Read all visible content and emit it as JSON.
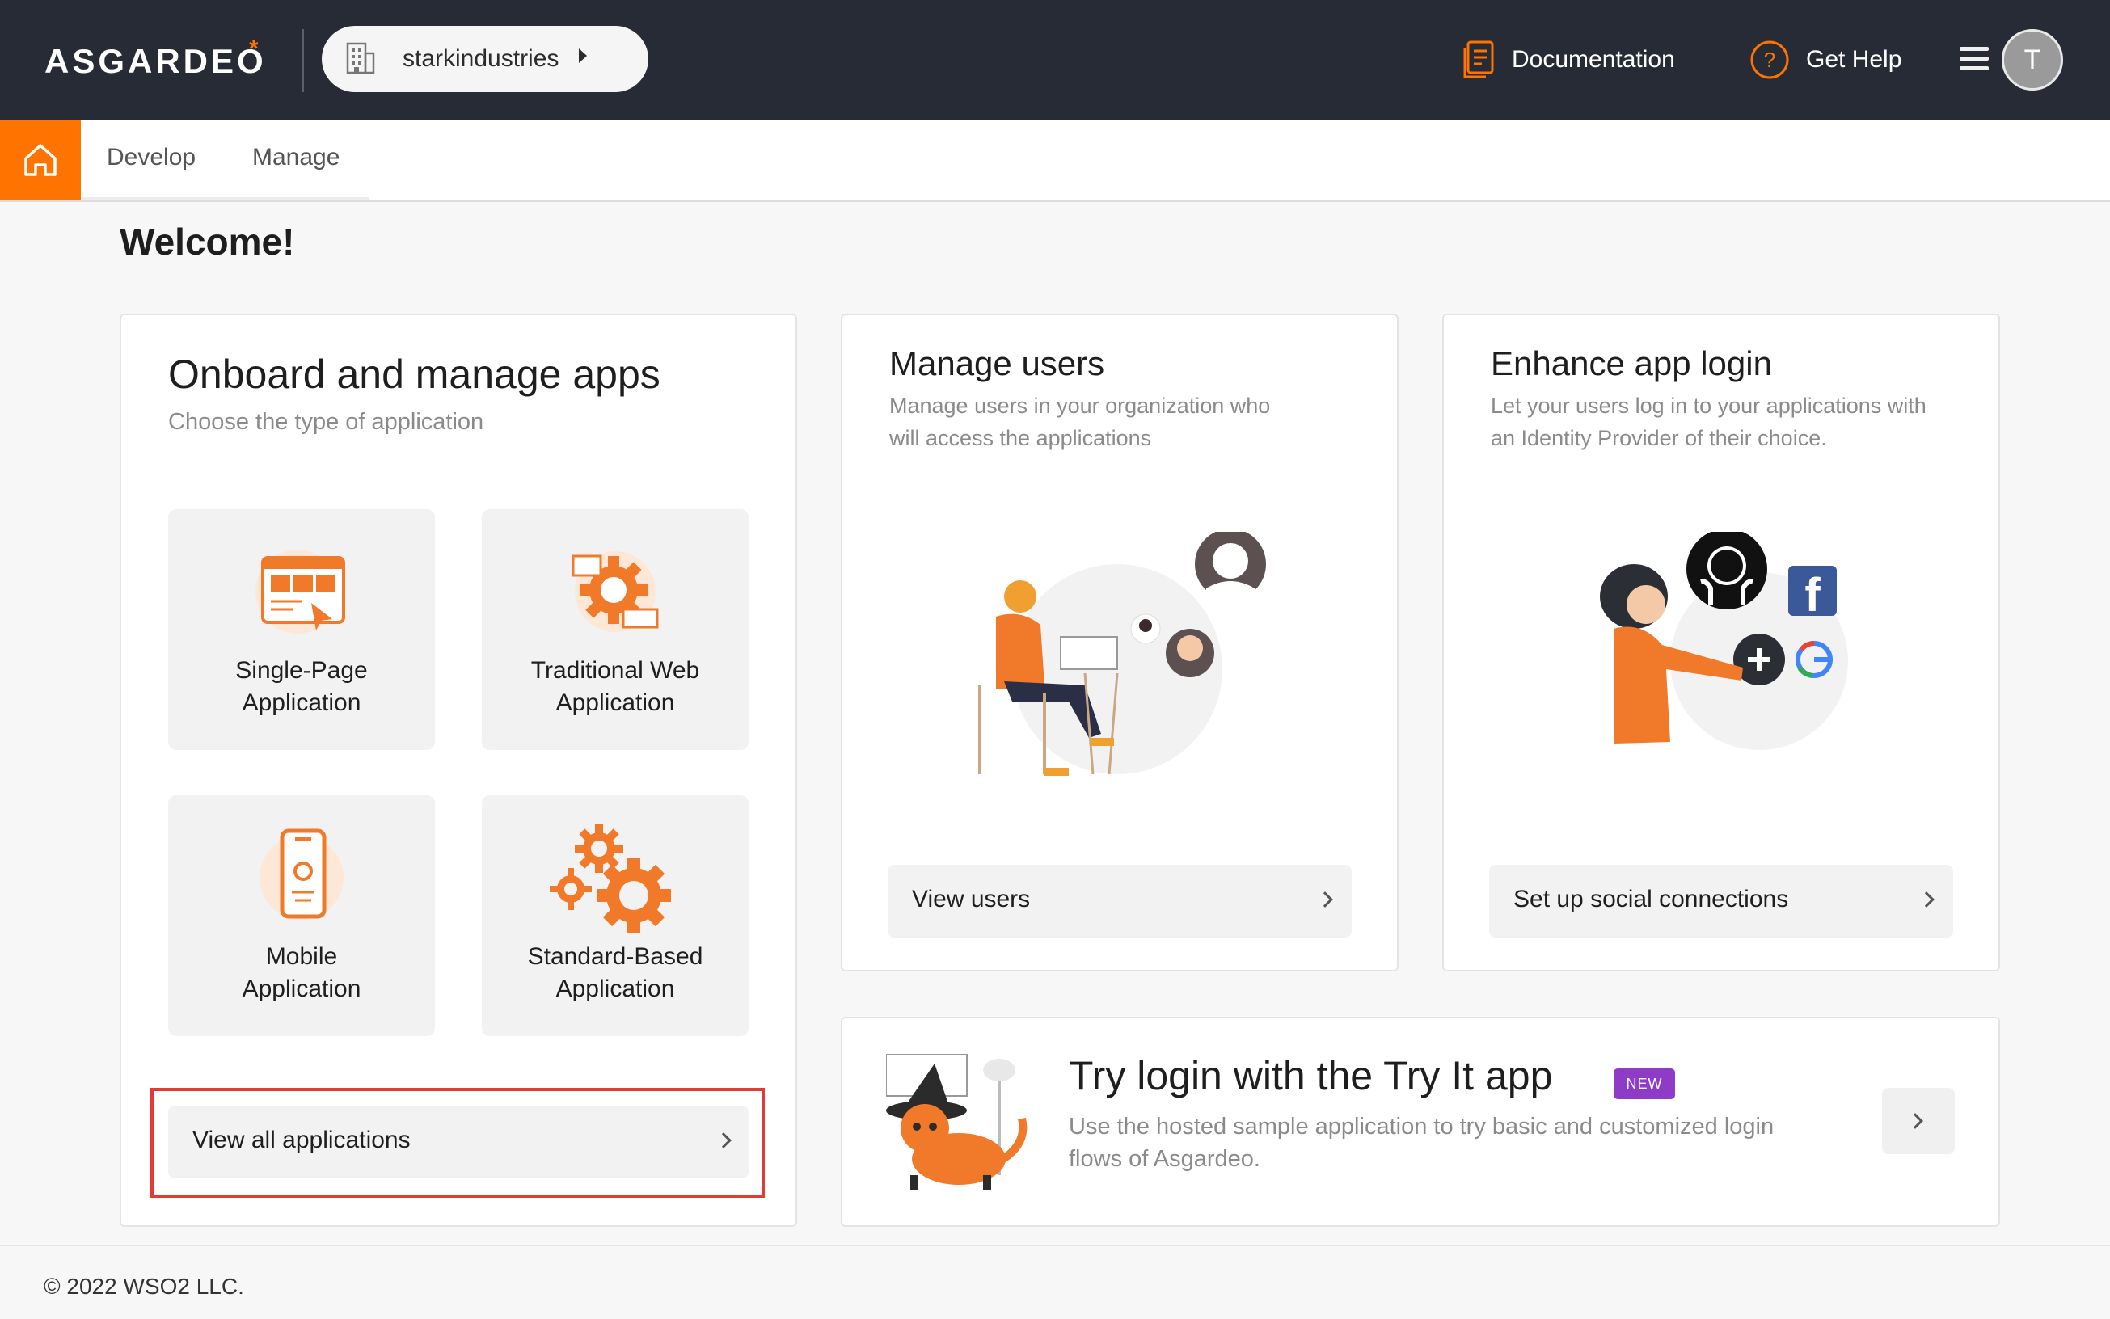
{
  "header": {
    "logo_text": "ASGARDEO",
    "logo_mark": "*",
    "org_name": "starkindustries",
    "documentation": "Documentation",
    "get_help": "Get Help",
    "avatar_initial": "T"
  },
  "nav": {
    "tabs": [
      "Develop",
      "Manage"
    ]
  },
  "page": {
    "welcome": "Welcome!"
  },
  "onboard_card": {
    "title": "Onboard and manage apps",
    "subtitle": "Choose the type of application",
    "tiles": [
      {
        "label_line1": "Single-Page",
        "label_line2": "Application",
        "icon": "spa-icon"
      },
      {
        "label_line1": "Traditional Web",
        "label_line2": "Application",
        "icon": "web-app-icon"
      },
      {
        "label_line1": "Mobile",
        "label_line2": "Application",
        "icon": "mobile-app-icon"
      },
      {
        "label_line1": "Standard-Based",
        "label_line2": "Application",
        "icon": "standard-app-icon"
      }
    ],
    "view_all": "View all applications"
  },
  "users_card": {
    "title": "Manage users",
    "subtitle_line1": "Manage users in your organization who",
    "subtitle_line2": "will access the applications",
    "action": "View users"
  },
  "login_card": {
    "title": "Enhance app login",
    "subtitle_line1": "Let your users log in to your applications with",
    "subtitle_line2": "an Identity Provider of their choice.",
    "action": "Set up social connections"
  },
  "try_card": {
    "title": "Try login with the Try It app",
    "badge": "NEW",
    "subtitle_line1": "Use the hosted sample application to try basic and customized login",
    "subtitle_line2": "flows of Asgardeo."
  },
  "footer": {
    "copyright": "© 2022 WSO2 LLC."
  },
  "colors": {
    "brand_orange": "#ff7300",
    "header_bg": "#262b35",
    "badge_purple": "#8e3cc8",
    "highlight_red": "#e53935"
  }
}
